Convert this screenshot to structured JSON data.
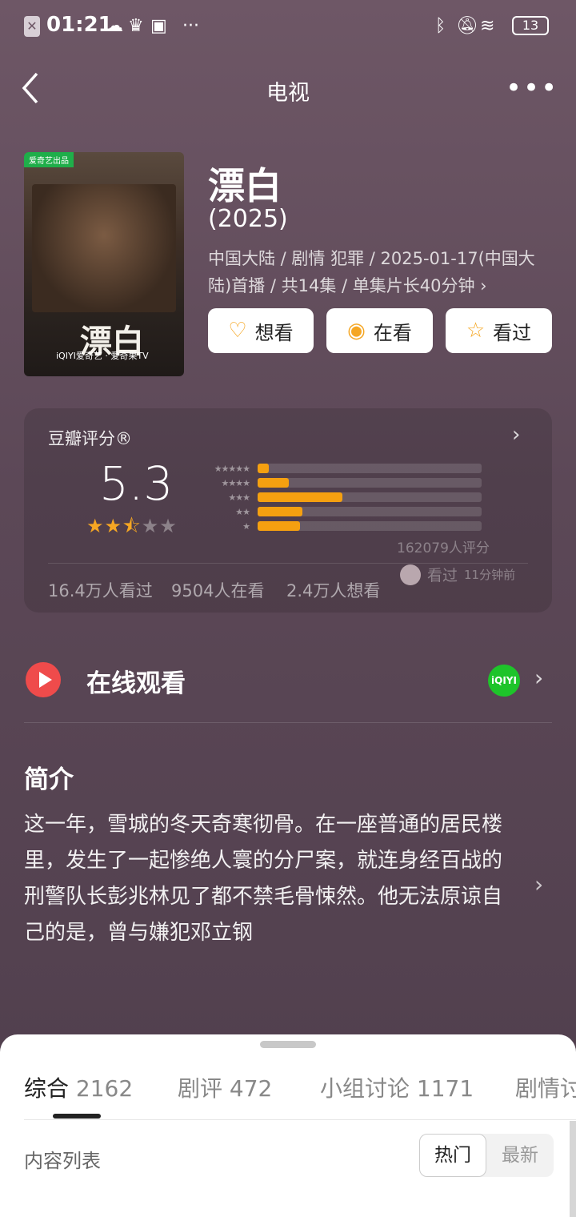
{
  "status_bar": {
    "time": "01:21",
    "battery": "13",
    "icons": [
      "sim-icon",
      "cloud-icon",
      "crown-icon",
      "bus-icon",
      "more-dots-icon",
      "bluetooth-icon",
      "bell-off-icon",
      "wifi-icon",
      "battery-icon"
    ]
  },
  "nav": {
    "title": "电视",
    "back_icon": "‹",
    "more_icon": "•••"
  },
  "poster": {
    "tag": "爱奇艺出品",
    "title_art": "漂白",
    "logos": "iQIYI爱奇艺 · 爱奇果TV"
  },
  "info": {
    "title": "漂白",
    "year": "(2025)",
    "meta": "中国大陆 / 剧情 犯罪 / 2025-01-17(中国大陆)首播 / 共14集 / 单集片长40分钟 ›"
  },
  "actions": {
    "want": "想看",
    "watching": "在看",
    "watched": "看过"
  },
  "rating": {
    "label": "豆瓣评分®",
    "score": "5.3",
    "stars": 2.5,
    "distribution": [
      {
        "stars": 5,
        "fraction": 0.05
      },
      {
        "stars": 4,
        "fraction": 0.14
      },
      {
        "stars": 3,
        "fraction": 0.38
      },
      {
        "stars": 2,
        "fraction": 0.2
      },
      {
        "stars": 1,
        "fraction": 0.19
      }
    ],
    "count": "162079人评分",
    "watched": "16.4万人看过",
    "watching": "9504人在看",
    "wanted": "2.4万人想看",
    "recent_action": "看过",
    "recent_time": "11分钟前"
  },
  "online": {
    "label": "在线观看",
    "platform": "iQIYI"
  },
  "intro": {
    "heading": "简介",
    "text": "这一年，雪城的冬天奇寒彻骨。在一座普通的居民楼里，发生了一起惨绝人寰的分尸案，就连身经百战的刑警队长彭兆林见了都不禁毛骨悚然。他无法原谅自己的是，曾与嫌犯邓立钢"
  },
  "sheet": {
    "tabs": [
      {
        "name": "综合",
        "count": "2162"
      },
      {
        "name": "剧评",
        "count": "472"
      },
      {
        "name": "小组讨论",
        "count": "1171"
      },
      {
        "name": "剧情讨",
        "count": ""
      }
    ],
    "list_label": "内容列表",
    "sort_hot": "热门",
    "sort_new": "最新"
  },
  "colors": {
    "accent": "#f5a623",
    "bar": "#f5a010",
    "play": "#ef4b4b",
    "iqiyi": "#1ec42a"
  }
}
